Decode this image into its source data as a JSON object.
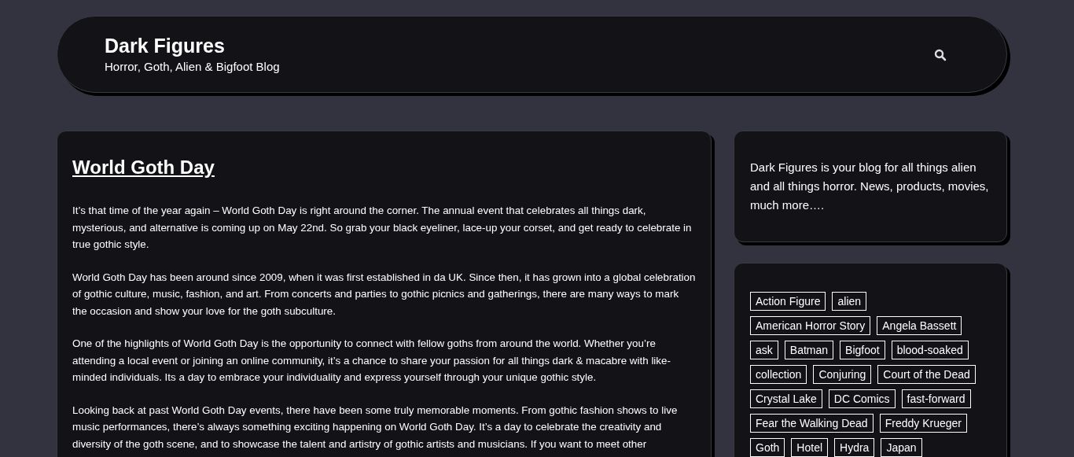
{
  "header": {
    "site_title": "Dark Figures",
    "tagline": "Horror, Goth, Alien & Bigfoot Blog"
  },
  "post": {
    "title": "World Goth Day",
    "paragraphs": [
      "It’s that time of the year again – World Goth Day is right around the corner. The annual event that celebrates all things dark, mysterious, and alternative is coming up on May 22nd. So grab your black eyeliner, lace-up your corset, and get ready to celebrate in true gothic style.",
      "World Goth Day has been around since 2009, when it was first established in da UK. Since then, it has grown into a global celebration of gothic culture, music, fashion, and art. From concerts and parties to gothic picnics and gatherings, there are many ways to mark the occasion and show your love for the goth subculture.",
      "One of the highlights of World Goth Day is the opportunity to connect with fellow goths from around the world. Whether you’re attending a local event or joining an online community, it’s a chance to share your passion for all things dark & macabre with like-minded individuals. Its a day to embrace your individuality and express yourself through your unique gothic style.",
      "Looking back at past World Goth Day events, there have been some truly memorable moments. From gothic fashion shows to live music performances, there’s always something exciting happening on World Goth Day. It’s a day to celebrate the creativity and diversity of the goth scene, and to showcase the talent and artistry of gothic artists and musicians. If you want to meet other"
    ]
  },
  "sidebar": {
    "about": "Dark Figures is your blog for all things alien and all things horror. News, products, movies, much more….",
    "tags": [
      "Action Figure",
      "alien",
      "American Horror Story",
      "Angela Bassett",
      "ask",
      "Batman",
      "Bigfoot",
      "blood-soaked",
      "collection",
      "Conjuring",
      "Court of the Dead",
      "Crystal Lake",
      "DC Comics",
      "fast-forward",
      "Fear the Walking Dead",
      "Freddy Krueger",
      "Goth",
      "Hotel",
      "Hydra",
      "Japan"
    ]
  }
}
